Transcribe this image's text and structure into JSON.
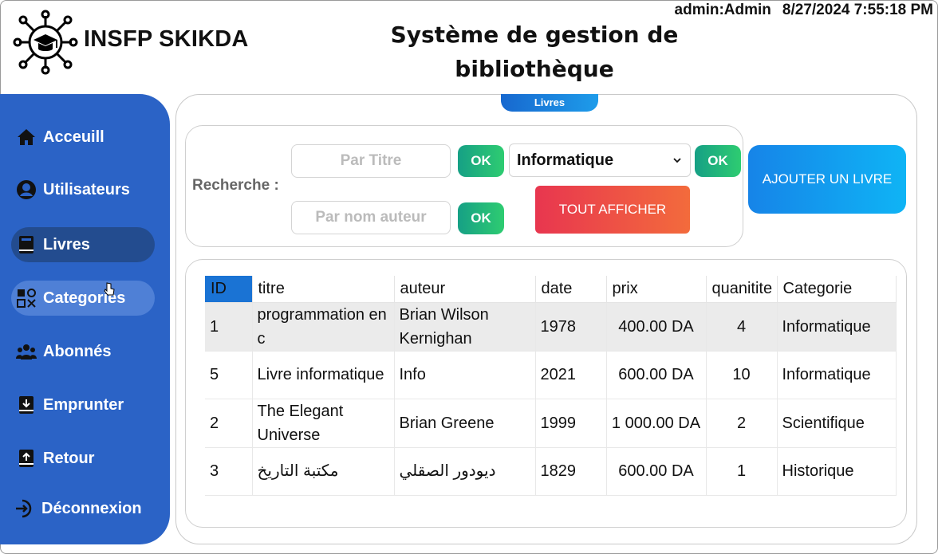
{
  "header": {
    "brand": "INSFP SKIKDA",
    "title_line1": "Système de gestion de",
    "title_line2": "bibliothèque",
    "user": "admin:Admin",
    "datetime": "8/27/2024 7:55:18 PM"
  },
  "sidebar": {
    "items": [
      {
        "label": "Acceuill",
        "icon": "home-icon"
      },
      {
        "label": "Utilisateurs",
        "icon": "user-icon"
      },
      {
        "label": "Livres",
        "icon": "book-icon"
      },
      {
        "label": "Categories",
        "icon": "categories-icon"
      },
      {
        "label": "Abonnés",
        "icon": "subscribers-icon"
      },
      {
        "label": "Emprunter",
        "icon": "borrow-icon"
      },
      {
        "label": "Retour",
        "icon": "return-icon"
      },
      {
        "label": "Déconnexion",
        "icon": "logout-icon"
      }
    ],
    "active": "Livres"
  },
  "main": {
    "tab_label": "Livres",
    "search": {
      "label": "Recherche :",
      "title_placeholder": "Par Titre",
      "author_placeholder": "Par nom auteur",
      "ok_label": "OK",
      "category_selected": "Informatique",
      "show_all_label": "TOUT AFFICHER"
    },
    "add_book_label": "AJOUTER UN LIVRE"
  },
  "table": {
    "columns": [
      "ID",
      "titre",
      "auteur",
      "date",
      "prix",
      "quanitite",
      "Categorie"
    ],
    "rows": [
      {
        "id": "1",
        "titre": "programmation en c",
        "auteur": "Brian Wilson Kernighan",
        "date": "1978",
        "prix": "400.00 DA",
        "quantite": "4",
        "categorie": "Informatique"
      },
      {
        "id": "5",
        "titre": "Livre informatique",
        "auteur": "Info",
        "date": "2021",
        "prix": "600.00 DA",
        "quantite": "10",
        "categorie": "Informatique"
      },
      {
        "id": "2",
        "titre": "The Elegant Universe",
        "auteur": "Brian Greene",
        "date": "1999",
        "prix": "1 000.00 DA",
        "quantite": "2",
        "categorie": "Scientifique"
      },
      {
        "id": "3",
        "titre": "مكتبة التاريخ",
        "auteur": "ديودور الصقلي",
        "date": "1829",
        "prix": "600.00 DA",
        "quantite": "1",
        "categorie": "Historique"
      }
    ]
  },
  "colors": {
    "sidebar": "#2b63c6",
    "sidebar_active": "#234c8f",
    "ok_gradient": [
      "#16a085",
      "#2ecc71"
    ],
    "show_all_gradient": [
      "#e8364f",
      "#f36b3c"
    ],
    "add_gradient": [
      "#1684e8",
      "#0fb4f5"
    ]
  }
}
